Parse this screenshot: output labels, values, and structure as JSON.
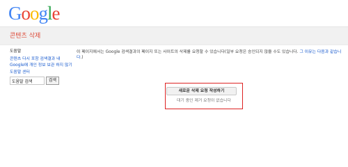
{
  "header": {
    "logo_text": "Google",
    "logo_letter_colors": [
      "#4285f4",
      "#ea4335",
      "#fbbc05",
      "#4285f4",
      "#34a853",
      "#ea4335"
    ],
    "page_title": "콘텐츠 삭제"
  },
  "sidebar": {
    "heading": "도움말",
    "links": [
      "콘텐츠 다시 포함 검색결과 내",
      "Google에 개인 정보 보관 하지 않기",
      "도움말 센터"
    ],
    "search": {
      "value": "도움말 검색",
      "button_label": "검색"
    }
  },
  "main": {
    "intro_prefix": "이 페이지에서는 Google 검색결과의 페이지 또는 사이트의 삭제를 요청할 수 있습니다(일부 요청은 승인되지 않을 수도 있습니다. ",
    "intro_link": "그 이유는 다음과 같습니다",
    "intro_suffix": ".)",
    "create_request_button": "새로운 삭제 요청 작성하기",
    "status": "대기 중인 제거 요청이 없습니다"
  }
}
